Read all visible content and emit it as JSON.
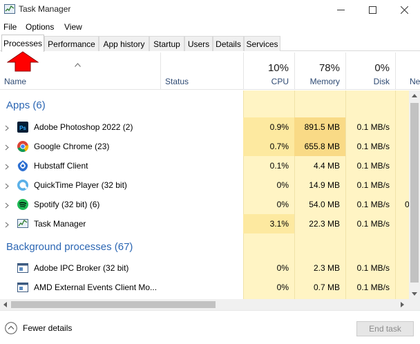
{
  "window": {
    "title": "Task Manager"
  },
  "menu": {
    "file": "File",
    "options": "Options",
    "view": "View"
  },
  "tabs": [
    "Processes",
    "Performance",
    "App history",
    "Startup",
    "Users",
    "Details",
    "Services"
  ],
  "columns": {
    "name": "Name",
    "status": "Status",
    "cpu": {
      "pct": "10%",
      "label": "CPU"
    },
    "memory": {
      "pct": "78%",
      "label": "Memory"
    },
    "disk": {
      "pct": "0%",
      "label": "Disk"
    },
    "network": {
      "label": "Ne"
    }
  },
  "groups": {
    "apps": "Apps (6)",
    "background": "Background processes (67)"
  },
  "apps": [
    {
      "name": "Adobe Photoshop 2022 (2)",
      "cpu": "0.9%",
      "memory": "891.5 MB",
      "disk": "0.1 MB/s",
      "net": "",
      "icon": "photoshop-icon"
    },
    {
      "name": "Google Chrome (23)",
      "cpu": "0.7%",
      "memory": "655.8 MB",
      "disk": "0.1 MB/s",
      "net": "",
      "icon": "chrome-icon"
    },
    {
      "name": "Hubstaff Client",
      "cpu": "0.1%",
      "memory": "4.4 MB",
      "disk": "0.1 MB/s",
      "net": "",
      "icon": "hubstaff-icon"
    },
    {
      "name": "QuickTime Player (32 bit)",
      "cpu": "0%",
      "memory": "14.9 MB",
      "disk": "0.1 MB/s",
      "net": "",
      "icon": "quicktime-icon"
    },
    {
      "name": "Spotify (32 bit) (6)",
      "cpu": "0%",
      "memory": "54.0 MB",
      "disk": "0.1 MB/s",
      "net": "0",
      "icon": "spotify-icon"
    },
    {
      "name": "Task Manager",
      "cpu": "3.1%",
      "memory": "22.3 MB",
      "disk": "0.1 MB/s",
      "net": "",
      "icon": "task-manager-icon"
    }
  ],
  "background": [
    {
      "name": "Adobe IPC Broker (32 bit)",
      "cpu": "0%",
      "memory": "2.3 MB",
      "disk": "0.1 MB/s",
      "net": "",
      "icon": "service-icon"
    },
    {
      "name": "AMD External Events Client Mo...",
      "cpu": "0%",
      "memory": "0.7 MB",
      "disk": "0.1 MB/s",
      "net": "",
      "icon": "service-icon"
    }
  ],
  "footer": {
    "fewer_details": "Fewer details",
    "end_task": "End task"
  },
  "colors": {
    "heat_low": "#fff4c4",
    "heat_mid": "#fde9a0",
    "heat_high": "#f9da86",
    "accent": "#2b66b3",
    "annotation_arrow": "#ff0000"
  }
}
